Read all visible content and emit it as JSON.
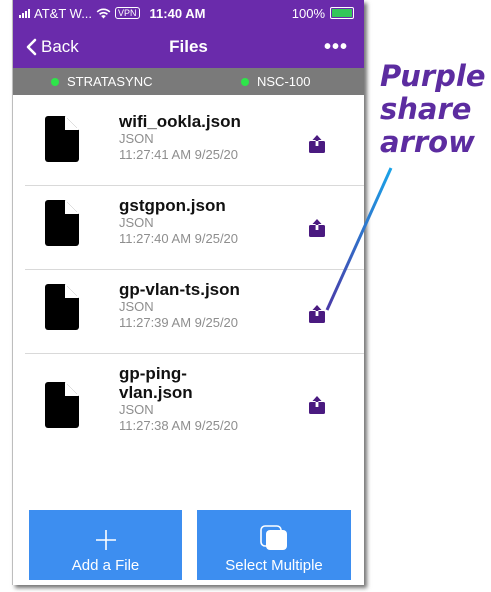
{
  "status_bar": {
    "carrier": "AT&T W...",
    "vpn": "VPN",
    "time": "11:40 AM",
    "battery": "100%",
    "battery_level": 1.0,
    "battery_color": "#34c759"
  },
  "nav": {
    "back_label": "Back",
    "title": "Files",
    "more_label": "•••"
  },
  "devices": [
    {
      "name": "STRATASYNC",
      "status_color": "#2ee54a"
    },
    {
      "name": "NSC-100",
      "status_color": "#2ee54a"
    }
  ],
  "files": [
    {
      "name": "wifi_ookla.json",
      "type": "JSON",
      "timestamp": "11:27:41 AM 9/25/20"
    },
    {
      "name": "gstgpon.json",
      "type": "JSON",
      "timestamp": "11:27:40 AM 9/25/20"
    },
    {
      "name": "gp-vlan-ts.json",
      "type": "JSON",
      "timestamp": "11:27:39 AM 9/25/20"
    },
    {
      "name": "gp-ping-vlan.json",
      "type": "JSON",
      "timestamp": "11:27:38 AM 9/25/20"
    }
  ],
  "actions": {
    "add_label": "Add a File",
    "select_label": "Select Multiple"
  },
  "annotation": {
    "line1": "Purple",
    "line2": "share",
    "line3": "arrow"
  },
  "colors": {
    "header": "#6a2bab",
    "device_bar": "#7a7a7a",
    "button": "#3d8ef0",
    "share_icon": "#4a1a80",
    "annotation": "#5c2ca0",
    "pointer": "#1aa3e8"
  }
}
